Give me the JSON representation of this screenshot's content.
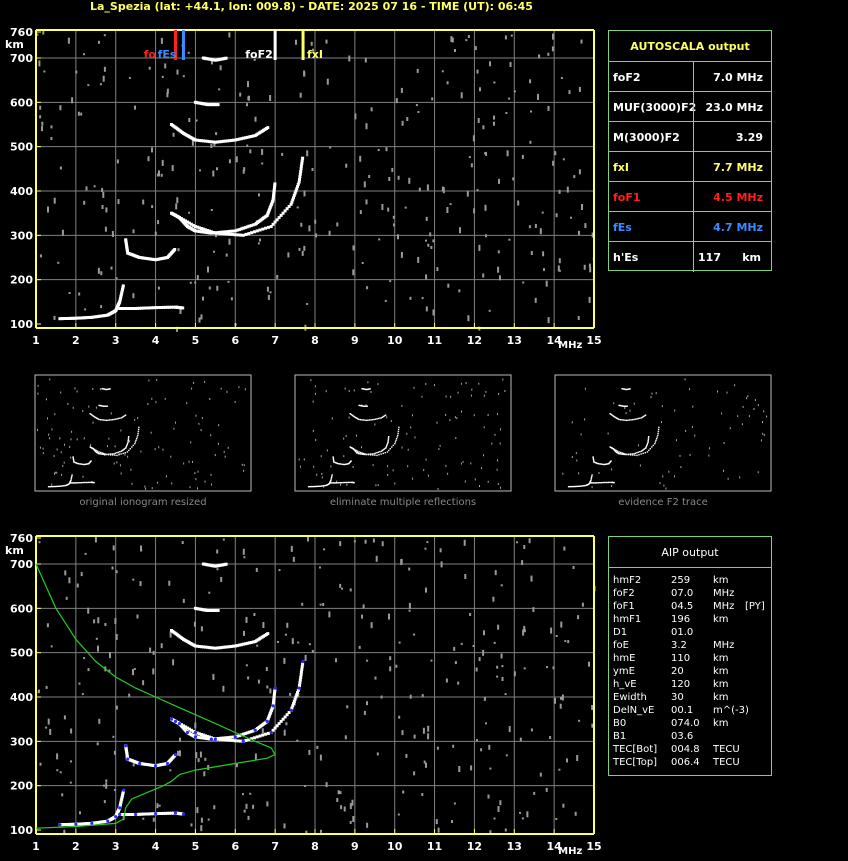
{
  "header": {
    "title": "La_Spezia (lat: +44.1, lon: 009.8) - DATE: 2025 07 16 - TIME (UT): 06:45"
  },
  "axes": {
    "km_label": "km",
    "mhz_label": "MHz",
    "y_ticks": [
      "760",
      "700",
      "600",
      "500",
      "400",
      "300",
      "200",
      "100"
    ],
    "x_ticks": [
      "1",
      "2",
      "3",
      "4",
      "5",
      "6",
      "7",
      "8",
      "9",
      "10",
      "11",
      "12",
      "13",
      "14",
      "15"
    ]
  },
  "markers": {
    "foE": "fo",
    "fEs": "fEs",
    "foF2": "foF2",
    "fxI": "fxI"
  },
  "autoscala": {
    "title": "AUTOSCALA output",
    "rows": [
      {
        "label": "foF2",
        "value": "7.0 MHz",
        "color": "#ffffff"
      },
      {
        "label": "MUF(3000)F2",
        "value": "23.0 MHz",
        "color": "#ffffff"
      },
      {
        "label": "M(3000)F2",
        "value": "3.29",
        "color": "#ffffff"
      },
      {
        "label": "fxI",
        "value": "7.7 MHz",
        "color": "#ffff66"
      },
      {
        "label": "foF1",
        "value": "4.5 MHz",
        "color": "#ff2020"
      },
      {
        "label": "fEs",
        "value": "4.7 MHz",
        "color": "#3c8cff"
      },
      {
        "label": "h'Es",
        "value": "117",
        "unit": "km",
        "color": "#ffffff"
      }
    ]
  },
  "thumbnails": [
    {
      "caption": "original ionogram resized"
    },
    {
      "caption": "eliminate multiple reflections"
    },
    {
      "caption": "evidence F2 trace"
    }
  ],
  "aip": {
    "title": "AIP output",
    "rows": [
      {
        "name": "hmF2",
        "value": "259",
        "unit": "km",
        "extra": ""
      },
      {
        "name": "foF2",
        "value": "07.0",
        "unit": "MHz",
        "extra": ""
      },
      {
        "name": "foF1",
        "value": "04.5",
        "unit": "MHz",
        "extra": "[PY]"
      },
      {
        "name": "hmF1",
        "value": "196",
        "unit": "km",
        "extra": ""
      },
      {
        "name": "D1",
        "value": "01.0",
        "unit": "",
        "extra": ""
      },
      {
        "name": "foE",
        "value": "3.2",
        "unit": "MHz",
        "extra": ""
      },
      {
        "name": "hmE",
        "value": "110",
        "unit": "km",
        "extra": ""
      },
      {
        "name": "ymE",
        "value": "20",
        "unit": "km",
        "extra": ""
      },
      {
        "name": "h_vE",
        "value": "120",
        "unit": "km",
        "extra": ""
      },
      {
        "name": "Ewidth",
        "value": "30",
        "unit": "km",
        "extra": ""
      },
      {
        "name": "DelN_vE",
        "value": "00.1",
        "unit": "m^(-3)",
        "extra": ""
      },
      {
        "name": "B0",
        "value": "074.0",
        "unit": "km",
        "extra": ""
      },
      {
        "name": "B1",
        "value": "03.6",
        "unit": "",
        "extra": ""
      },
      {
        "name": "TEC[Bot]",
        "value": "004.8",
        "unit": "TECU",
        "extra": ""
      },
      {
        "name": "TEC[Top]",
        "value": "006.4",
        "unit": "TECU",
        "extra": ""
      }
    ]
  },
  "colors": {
    "axis": "#ffff66",
    "grid": "#808080",
    "trace": "#ffffff",
    "noise": "#9a9a9a",
    "table_border": "#7fd07f",
    "profile": "#22cc22",
    "fit": "#2a2aff",
    "foF1_marker": "#ff2020",
    "fEs_marker": "#3c8cff",
    "foF2_marker": "#ffffff",
    "fxI_marker": "#ffff66"
  },
  "chart_data": {
    "type": "scatter",
    "x_range": [
      1,
      15
    ],
    "y_range": [
      100,
      760
    ],
    "grid": true,
    "traces": [
      {
        "name": "E",
        "points": [
          [
            1.6,
            112
          ],
          [
            2.0,
            113
          ],
          [
            2.4,
            115
          ],
          [
            2.8,
            120
          ],
          [
            3.0,
            130
          ],
          [
            3.1,
            150
          ],
          [
            3.2,
            190
          ]
        ]
      },
      {
        "name": "Es",
        "points": [
          [
            3.1,
            135
          ],
          [
            3.5,
            135
          ],
          [
            4.0,
            137
          ],
          [
            4.5,
            138
          ],
          [
            4.7,
            136
          ]
        ]
      },
      {
        "name": "F1",
        "points": [
          [
            3.25,
            290
          ],
          [
            3.3,
            260
          ],
          [
            3.6,
            250
          ],
          [
            4.0,
            245
          ],
          [
            4.3,
            250
          ],
          [
            4.5,
            270
          ]
        ]
      },
      {
        "name": "F2",
        "points": [
          [
            4.4,
            350
          ],
          [
            4.6,
            340
          ],
          [
            4.8,
            320
          ],
          [
            5.0,
            310
          ],
          [
            5.4,
            305
          ],
          [
            6.0,
            310
          ],
          [
            6.5,
            325
          ],
          [
            6.8,
            345
          ],
          [
            6.95,
            380
          ],
          [
            7.0,
            420
          ]
        ]
      },
      {
        "name": "F2x",
        "points": [
          [
            4.5,
            345
          ],
          [
            5.0,
            320
          ],
          [
            5.5,
            305
          ],
          [
            6.2,
            300
          ],
          [
            6.9,
            320
          ],
          [
            7.4,
            370
          ],
          [
            7.6,
            420
          ],
          [
            7.7,
            480
          ]
        ]
      },
      {
        "name": "multiple1",
        "points": [
          [
            4.4,
            550
          ],
          [
            4.7,
            530
          ],
          [
            5.0,
            515
          ],
          [
            5.5,
            510
          ],
          [
            6.0,
            515
          ],
          [
            6.5,
            525
          ],
          [
            6.85,
            545
          ]
        ]
      },
      {
        "name": "multiple2",
        "points": [
          [
            5.0,
            600
          ],
          [
            5.3,
            595
          ],
          [
            5.6,
            595
          ]
        ]
      },
      {
        "name": "multiple3",
        "points": [
          [
            5.2,
            700
          ],
          [
            5.5,
            695
          ],
          [
            5.8,
            700
          ]
        ]
      }
    ],
    "profile": [
      [
        1.0,
        700
      ],
      [
        1.5,
        600
      ],
      [
        2.0,
        530
      ],
      [
        2.5,
        480
      ],
      [
        3.0,
        445
      ],
      [
        3.5,
        420
      ],
      [
        4.0,
        400
      ],
      [
        4.5,
        380
      ],
      [
        5.0,
        360
      ],
      [
        5.5,
        340
      ],
      [
        6.0,
        320
      ],
      [
        6.5,
        300
      ],
      [
        6.9,
        285
      ],
      [
        7.0,
        270
      ],
      [
        6.8,
        262
      ],
      [
        6.0,
        250
      ],
      [
        5.0,
        235
      ],
      [
        4.6,
        225
      ],
      [
        4.4,
        210
      ],
      [
        4.2,
        200
      ],
      [
        3.8,
        185
      ],
      [
        3.4,
        170
      ],
      [
        3.25,
        150
      ],
      [
        3.2,
        125
      ],
      [
        3.0,
        115
      ],
      [
        2.0,
        108
      ],
      [
        1.0,
        104
      ]
    ]
  }
}
